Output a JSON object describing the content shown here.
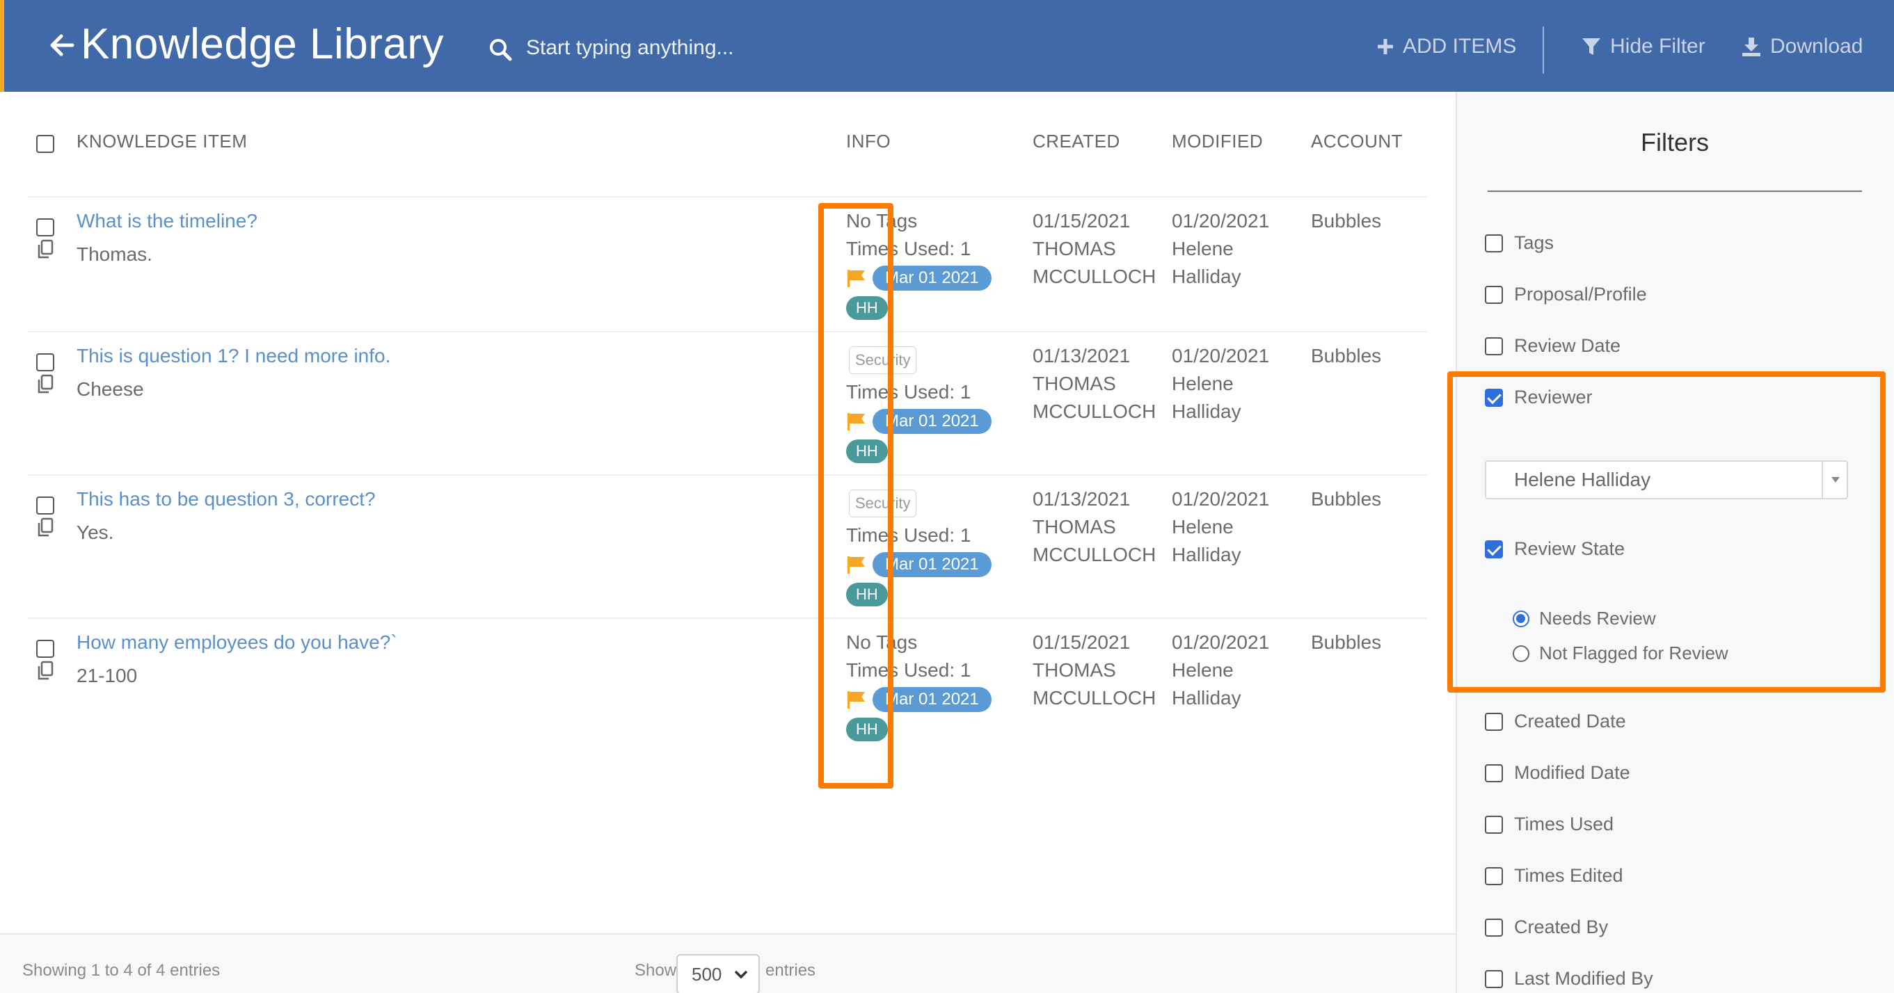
{
  "header": {
    "title": "Knowledge Library",
    "search_placeholder": "Start typing anything...",
    "add_items": "ADD ITEMS",
    "hide_filter": "Hide Filter",
    "download": "Download"
  },
  "table": {
    "columns": {
      "item": "KNOWLEDGE ITEM",
      "info": "INFO",
      "created": "CREATED",
      "modified": "MODIFIED",
      "account": "ACCOUNT"
    },
    "rows": [
      {
        "question": "What is the timeline?",
        "answer": "Thomas.",
        "tag": "No Tags",
        "times_used": "Times Used: 1",
        "review_date": "Mar 01 2021",
        "reviewer_initials": "HH",
        "created_date": "01/15/2021",
        "created_by_1": "THOMAS",
        "created_by_2": "MCCULLOCH",
        "modified_date": "01/20/2021",
        "modified_by_1": "Helene",
        "modified_by_2": "Halliday",
        "account": "Bubbles"
      },
      {
        "question": "This is question 1? I need more info.",
        "answer": "Cheese",
        "tag": "Security",
        "times_used": "Times Used: 1",
        "review_date": "Mar 01 2021",
        "reviewer_initials": "HH",
        "created_date": "01/13/2021",
        "created_by_1": "THOMAS",
        "created_by_2": "MCCULLOCH",
        "modified_date": "01/20/2021",
        "modified_by_1": "Helene",
        "modified_by_2": "Halliday",
        "account": "Bubbles"
      },
      {
        "question": "This has to be question 3, correct?",
        "answer": "Yes.",
        "tag": "Security",
        "times_used": "Times Used: 1",
        "review_date": "Mar 01 2021",
        "reviewer_initials": "HH",
        "created_date": "01/13/2021",
        "created_by_1": "THOMAS",
        "created_by_2": "MCCULLOCH",
        "modified_date": "01/20/2021",
        "modified_by_1": "Helene",
        "modified_by_2": "Halliday",
        "account": "Bubbles"
      },
      {
        "question": "How many employees do you have?`",
        "answer": "21-100",
        "tag": "No Tags",
        "times_used": "Times Used: 1",
        "review_date": "Mar 01 2021",
        "reviewer_initials": "HH",
        "created_date": "01/15/2021",
        "created_by_1": "THOMAS",
        "created_by_2": "MCCULLOCH",
        "modified_date": "01/20/2021",
        "modified_by_1": "Helene",
        "modified_by_2": "Halliday",
        "account": "Bubbles"
      }
    ]
  },
  "footer": {
    "showing": "Showing 1 to 4 of 4 entries",
    "show_label": "Show",
    "show_value": "500",
    "entries_label": "entries"
  },
  "filters": {
    "title": "Filters",
    "tags": "Tags",
    "proposal_profile": "Proposal/Profile",
    "review_date": "Review Date",
    "reviewer": "Reviewer",
    "reviewer_value": "Helene Halliday",
    "review_state": "Review State",
    "needs_review": "Needs Review",
    "not_flagged": "Not Flagged for Review",
    "created_date": "Created Date",
    "modified_date": "Modified Date",
    "times_used": "Times Used",
    "times_edited": "Times Edited",
    "created_by": "Created By",
    "last_modified_by": "Last Modified By"
  },
  "colors": {
    "header_bg": "#4169a8",
    "accent_orange": "#ff7a00",
    "link_blue": "#5b8fc9",
    "date_pill": "#5b9bd5",
    "reviewer_pill": "#4a9a9c",
    "flag": "#f6a623",
    "check_blue": "#2f6fdb"
  }
}
